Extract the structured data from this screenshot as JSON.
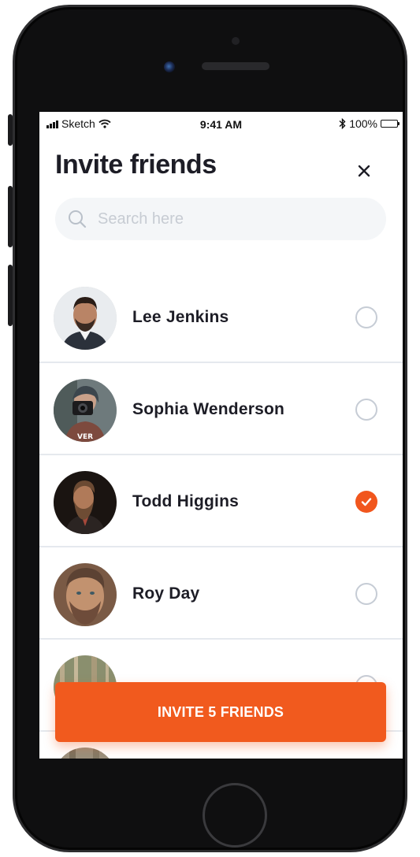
{
  "status_bar": {
    "carrier": "Sketch",
    "time": "9:41 AM",
    "battery": "100%"
  },
  "header": {
    "title": "Invite friends",
    "close_icon": "close-icon"
  },
  "search": {
    "placeholder": "Search here",
    "icon": "search-icon"
  },
  "friends": [
    {
      "name": "Lee Jenkins",
      "selected": false
    },
    {
      "name": "Sophia Wenderson",
      "selected": false
    },
    {
      "name": "Todd Higgins",
      "selected": true
    },
    {
      "name": "Roy Day",
      "selected": false
    },
    {
      "name": "",
      "selected": false
    }
  ],
  "cta": {
    "label": "INVITE 5 FRIENDS"
  },
  "colors": {
    "accent": "#f15a1e",
    "text": "#1d1d26",
    "divider": "#e5e9ee",
    "search_bg": "#f4f6f8"
  }
}
